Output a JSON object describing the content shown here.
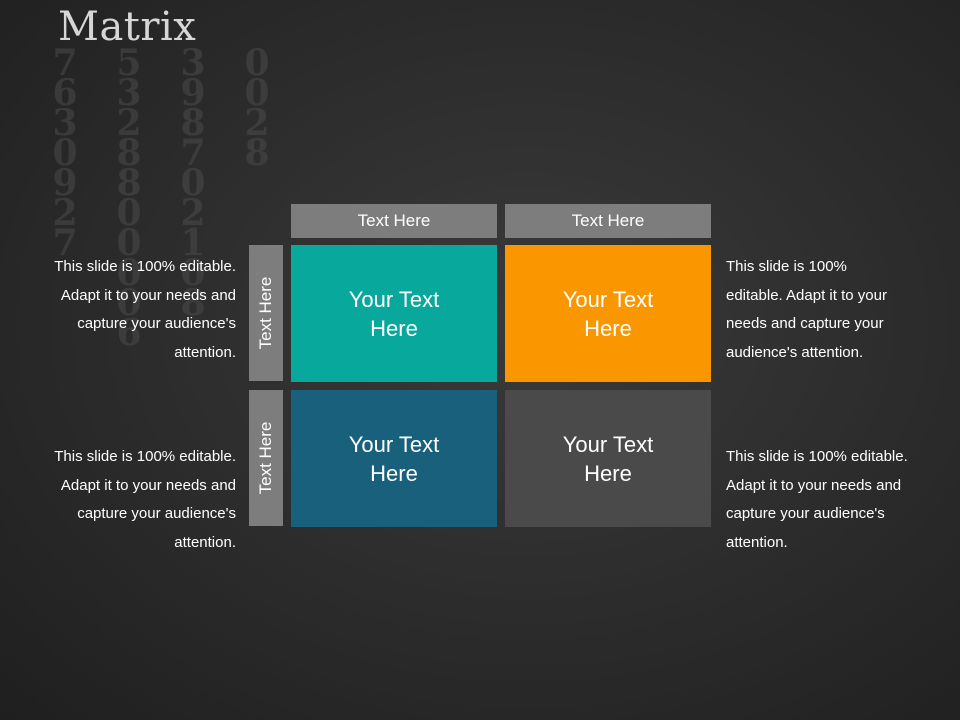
{
  "title": "Matrix",
  "columns": [
    {
      "label": "Text Here"
    },
    {
      "label": "Text Here"
    }
  ],
  "rows": [
    {
      "label": "Text Here"
    },
    {
      "label": "Text Here"
    }
  ],
  "cells": [
    {
      "text": "Your Text Here",
      "color": "#08a89c"
    },
    {
      "text": "Your Text Here",
      "color": "#fa9600"
    },
    {
      "text": "Your Text Here",
      "color": "#18607b"
    },
    {
      "text": "Your Text Here",
      "color": "#4a4a4a"
    }
  ],
  "descriptions": {
    "top_left": "This slide is 100% editable. Adapt it to your needs and capture your audience's attention.",
    "top_right": "This slide is 100% editable. Adapt it to your needs and capture your audience's attention.",
    "bottom_left": "This slide is 100% editable. Adapt it to your needs and capture your audience's attention.",
    "bottom_right": "This slide is 100% editable. Adapt it to your needs and capture your audience's attention."
  },
  "colors": {
    "header_gray": "#7d7d7d",
    "background": "#2b2b2b"
  }
}
